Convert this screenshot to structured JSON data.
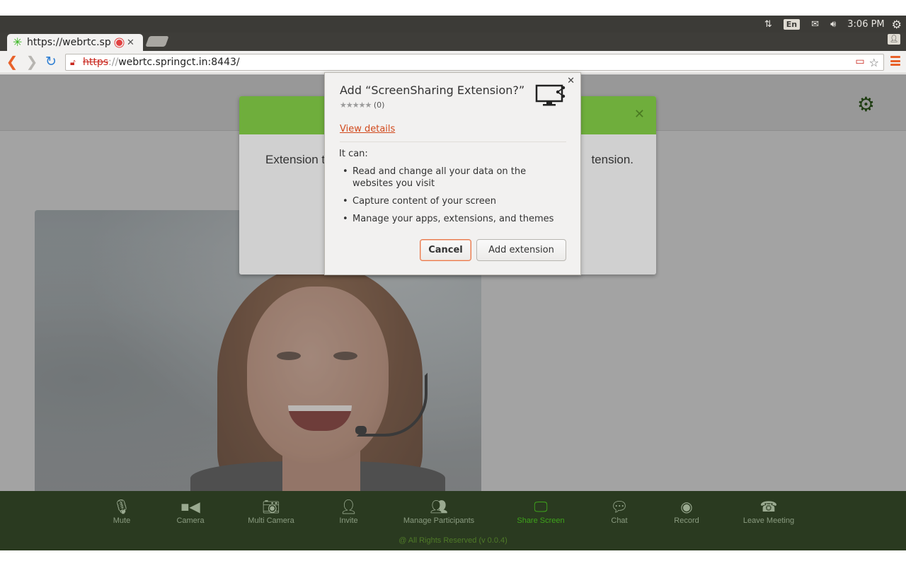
{
  "os_panel": {
    "keyboard_layout": "En",
    "clock": "3:06 PM"
  },
  "browser": {
    "tab": {
      "title": "https://webrtc.sp"
    },
    "address": {
      "scheme": "https",
      "separator": "://",
      "host": "webrtc.springct.in:8443/"
    }
  },
  "ext_modal": {
    "text_left": "Extension t",
    "text_right": "tension."
  },
  "dialog": {
    "title": "Add “ScreenSharing Extension?”",
    "rating_count": "(0)",
    "view_details": "View details",
    "it_can": "It can:",
    "permissions": [
      "Read and change all your data on the websites you visit",
      "Capture content of your screen",
      "Manage your apps, extensions, and themes"
    ],
    "cancel_label": "Cancel",
    "add_label": "Add extension"
  },
  "controls": [
    {
      "label": "Mute",
      "icon": "microphone-icon"
    },
    {
      "label": "Camera",
      "icon": "video-camera-icon"
    },
    {
      "label": "Multi Camera",
      "icon": "photo-camera-icon"
    },
    {
      "label": "Invite",
      "icon": "add-user-icon"
    },
    {
      "label": "Manage Participants",
      "icon": "participants-icon"
    },
    {
      "label": "Share Screen",
      "icon": "share-screen-icon"
    },
    {
      "label": "Chat",
      "icon": "chat-icon"
    },
    {
      "label": "Record",
      "icon": "record-icon"
    },
    {
      "label": "Leave Meeting",
      "icon": "hangup-icon"
    }
  ],
  "footer": "@ All Rights Reserved (v 0.0.4)",
  "colors": {
    "accent_green": "#3ea31b",
    "modal_header_green": "#6fae3c",
    "control_bar": "#2a3a20",
    "dialog_link": "#d1491c"
  }
}
